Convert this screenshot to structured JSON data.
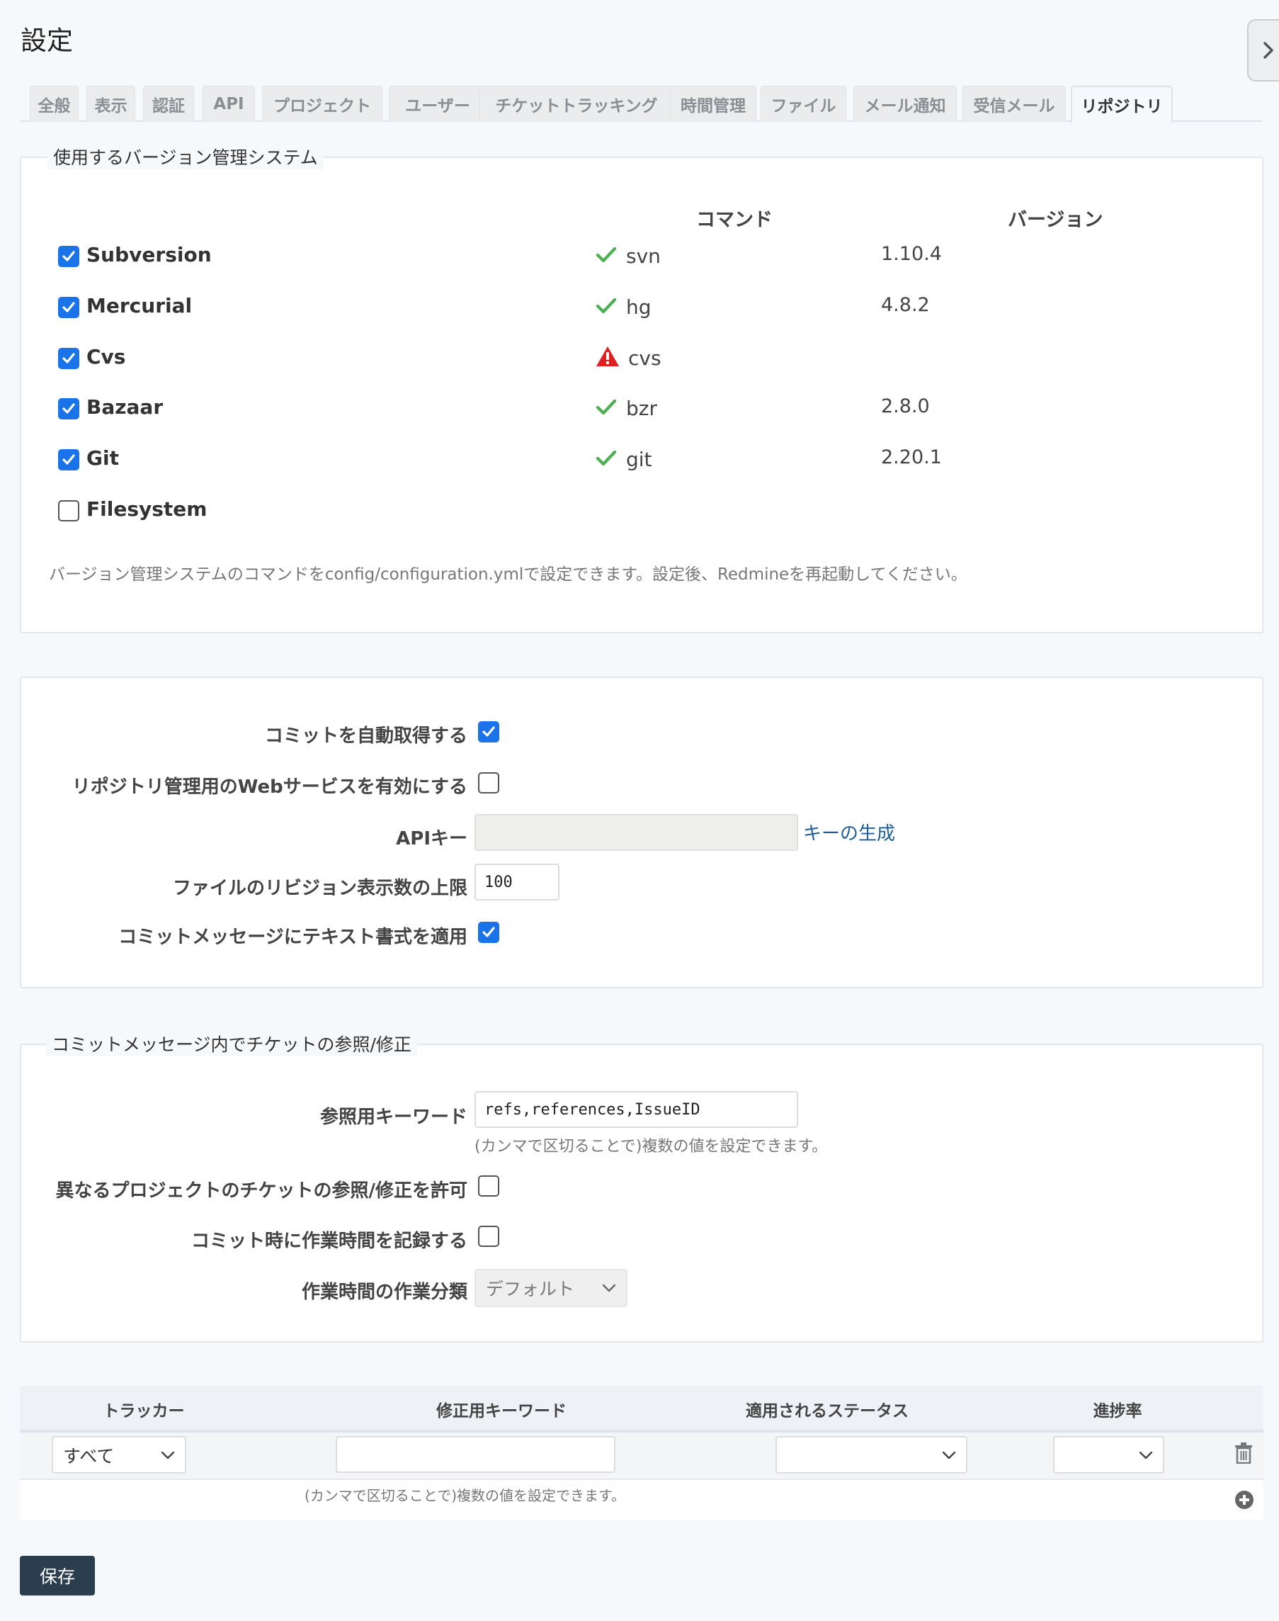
{
  "page": {
    "title": "設定"
  },
  "tabs": [
    {
      "label": "全般"
    },
    {
      "label": "表示"
    },
    {
      "label": "認証"
    },
    {
      "label": "API"
    },
    {
      "label": "プロジェクト"
    },
    {
      "label": "ユーザー"
    },
    {
      "label": "チケットトラッキング"
    },
    {
      "label": "時間管理"
    },
    {
      "label": "ファイル"
    },
    {
      "label": "メール通知"
    },
    {
      "label": "受信メール"
    },
    {
      "label": "リポジトリ"
    }
  ],
  "active_tab": "リポジトリ",
  "scm": {
    "legend": "使用するバージョン管理システム",
    "col_command": "コマンド",
    "col_version": "バージョン",
    "rows": [
      {
        "name": "Subversion",
        "checked": true,
        "command": "svn",
        "status": "ok",
        "version": "1.10.4"
      },
      {
        "name": "Mercurial",
        "checked": true,
        "command": "hg",
        "status": "ok",
        "version": "4.8.2"
      },
      {
        "name": "Cvs",
        "checked": true,
        "command": "cvs",
        "status": "warning",
        "version": ""
      },
      {
        "name": "Bazaar",
        "checked": true,
        "command": "bzr",
        "status": "ok",
        "version": "2.8.0"
      },
      {
        "name": "Git",
        "checked": true,
        "command": "git",
        "status": "ok",
        "version": "2.20.1"
      },
      {
        "name": "Filesystem",
        "checked": false,
        "command": "",
        "status": "",
        "version": ""
      }
    ],
    "hint": "バージョン管理システムのコマンドをconfig/configuration.ymlで設定できます。設定後、Redmineを再起動してください。"
  },
  "general": {
    "autofetch_label": "コミットを自動取得する",
    "autofetch_checked": true,
    "ws_label": "リポジトリ管理用のWebサービスを有効にする",
    "ws_checked": false,
    "api_key_label": "APIキー",
    "api_key_value": "",
    "generate_key_link": "キーの生成",
    "max_revisions_label": "ファイルのリビジョン表示数の上限",
    "max_revisions_value": "100",
    "text_format_label": "コミットメッセージにテキスト書式を適用",
    "text_format_checked": true
  },
  "refs": {
    "legend": "コミットメッセージ内でチケットの参照/修正",
    "keywords_label": "参照用キーワード",
    "keywords_value": "refs,references,IssueID",
    "keywords_hint": "(カンマで区切ることで)複数の値を設定できます。",
    "cross_project_label": "異なるプロジェクトのチケットの参照/修正を許可",
    "cross_project_checked": false,
    "log_time_label": "コミット時に作業時間を記録する",
    "log_time_checked": false,
    "activity_label": "作業時間の作業分類",
    "activity_value": "デフォルト"
  },
  "fix_table": {
    "headers": {
      "tracker": "トラッカー",
      "keywords": "修正用キーワード",
      "status": "適用されるステータス",
      "done_ratio": "進捗率"
    },
    "row": {
      "tracker": "すべて",
      "keywords": "",
      "status": "",
      "done_ratio": ""
    },
    "hint": "(カンマで区切ることで)複数の値を設定できます。"
  },
  "save_label": "保存",
  "colors": {
    "accent": "#1a73e8",
    "ok": "#4caf50",
    "warning": "#e02020",
    "link": "#1f5e96",
    "button": "#2b3e50"
  }
}
